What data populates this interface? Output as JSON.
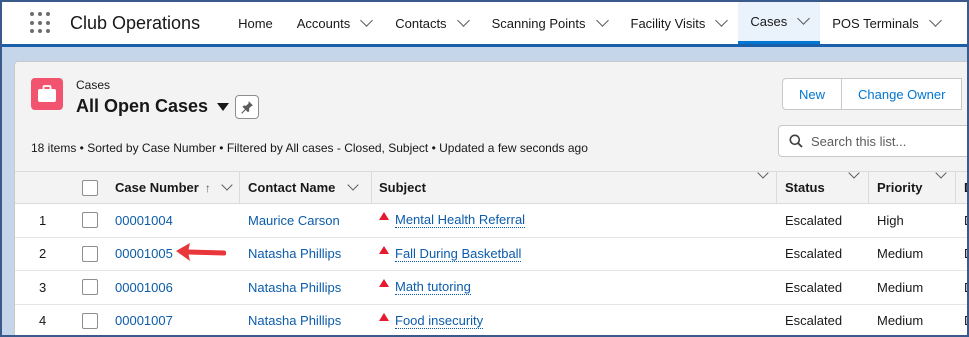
{
  "nav": {
    "app_name": "Club Operations",
    "items": [
      {
        "label": "Home",
        "dropdown": false,
        "active": false
      },
      {
        "label": "Accounts",
        "dropdown": true,
        "active": false
      },
      {
        "label": "Contacts",
        "dropdown": true,
        "active": false
      },
      {
        "label": "Scanning Points",
        "dropdown": true,
        "active": false
      },
      {
        "label": "Facility Visits",
        "dropdown": true,
        "active": false
      },
      {
        "label": "Cases",
        "dropdown": true,
        "active": true
      },
      {
        "label": "POS Terminals",
        "dropdown": true,
        "active": false
      }
    ]
  },
  "header": {
    "object_label": "Cases",
    "list_view_name": "All Open Cases",
    "meta": "18 items • Sorted by Case Number • Filtered by All cases - Closed, Subject • Updated a few seconds ago",
    "buttons": [
      "New",
      "Change Owner"
    ],
    "search_placeholder": "Search this list..."
  },
  "table": {
    "columns": [
      "Case Number",
      "Contact Name",
      "Subject",
      "Status",
      "Priority",
      "D"
    ],
    "rows": [
      {
        "num": "1",
        "case": "00001004",
        "contact": "Maurice Carson",
        "subject": "Mental Health Referral",
        "status": "Escalated",
        "priority": "High",
        "d": "D"
      },
      {
        "num": "2",
        "case": "00001005",
        "contact": "Natasha Phillips",
        "subject": "Fall During Basketball",
        "status": "Escalated",
        "priority": "Medium",
        "d": "D"
      },
      {
        "num": "3",
        "case": "00001006",
        "contact": "Natasha Phillips",
        "subject": "Math tutoring",
        "status": "Escalated",
        "priority": "Medium",
        "d": "D"
      },
      {
        "num": "4",
        "case": "00001007",
        "contact": "Natasha Phillips",
        "subject": "Food insecurity",
        "status": "Escalated",
        "priority": "Medium",
        "d": "D"
      }
    ]
  },
  "colors": {
    "accent": "#0176d3",
    "case_icon": "#f2536f",
    "annotation_arrow": "#e8363a"
  }
}
